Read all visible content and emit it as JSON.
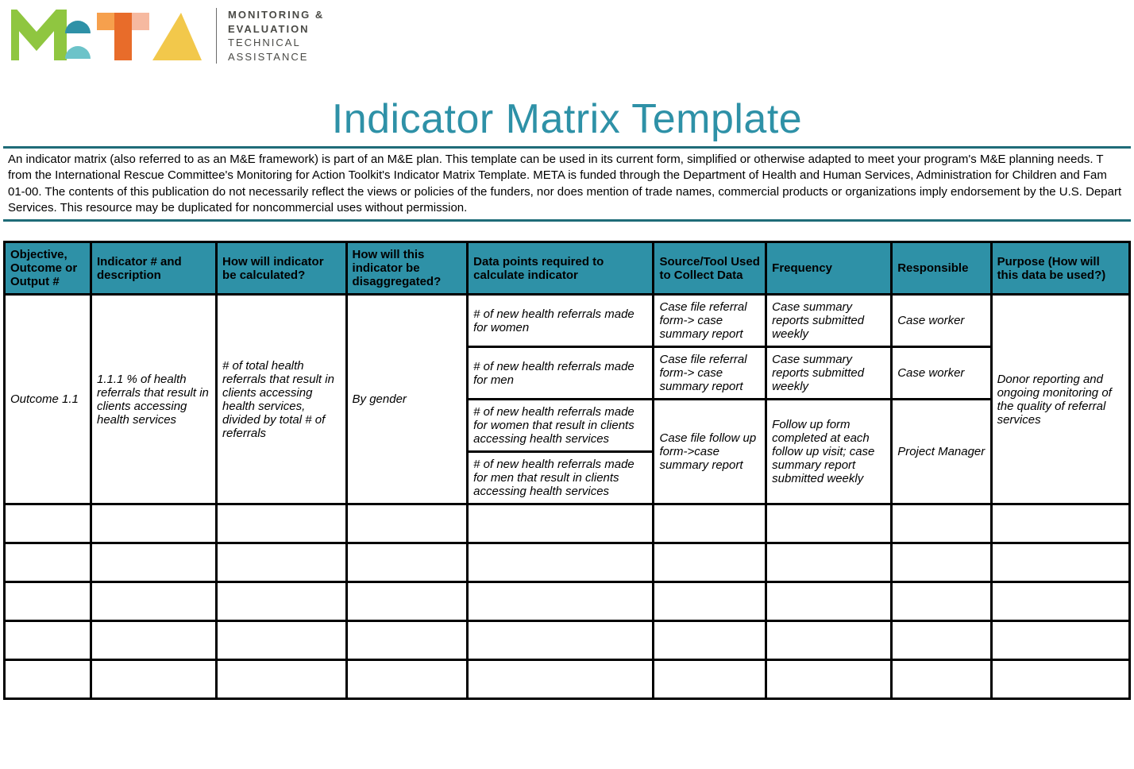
{
  "logo": {
    "acronym": "META",
    "tagline_bold1": "MONITORING &",
    "tagline_bold2": "EVALUATION",
    "tagline_light1": "TECHNICAL",
    "tagline_light2": "ASSISTANCE"
  },
  "title": "Indicator Matrix Template",
  "intro_text": "An indicator matrix (also referred to as an M&E framework) is part of an M&E plan.  This template can be used in its current form, simplified or otherwise adapted to meet your program's M&E planning needs.  T from the International Rescue Committee's Monitoring for Action Toolkit's Indicator Matrix Template. META is funded through the Department of Health and Human Services, Administration for Children and Fam 01-00. The contents of this publication do not necessarily reflect the views or policies of the funders, nor does mention of trade names, commercial products or organizations imply endorsement by the U.S. Depart Services. This resource may be duplicated for noncommercial uses without permission.",
  "headers": {
    "c1": "Objective, Outcome or Output #",
    "c2": "Indicator # and description",
    "c3": "How will indicator be calculated?",
    "c4": "How will this indicator be disaggregated?",
    "c5": "Data points required to calculate indicator",
    "c6": "Source/Tool Used to Collect Data",
    "c7": "Frequency",
    "c8": "Responsible",
    "c9": "Purpose (How will this data be used?)"
  },
  "row1": {
    "objective": "Outcome 1.1",
    "indicator": "1.1.1 % of health referrals that result in clients accessing health services",
    "calculation": "# of total health referrals that result in clients accessing health services, divided by total # of referrals",
    "disaggregation": "By gender",
    "purpose": "Donor reporting and ongoing monitoring of the quality of referral services"
  },
  "sub": {
    "dp1": "# of new health referrals made for women",
    "src1": "Case file referral form-> case summary report",
    "freq1": "Case summary reports submitted weekly",
    "resp1": "Case worker",
    "dp2": "# of new health referrals made for men",
    "src2": "Case file referral form-> case summary report",
    "freq2": "Case summary reports submitted weekly",
    "resp2": "Case worker",
    "dp3": "# of new health referrals made for women that result in clients accessing health services",
    "dp4": "# of new health referrals made for men that result in clients accessing health services",
    "src34": "Case file follow up form->case summary report",
    "freq34": "Follow up form completed at each follow up visit; case summary report submitted weekly",
    "resp34": "Project Manager"
  }
}
